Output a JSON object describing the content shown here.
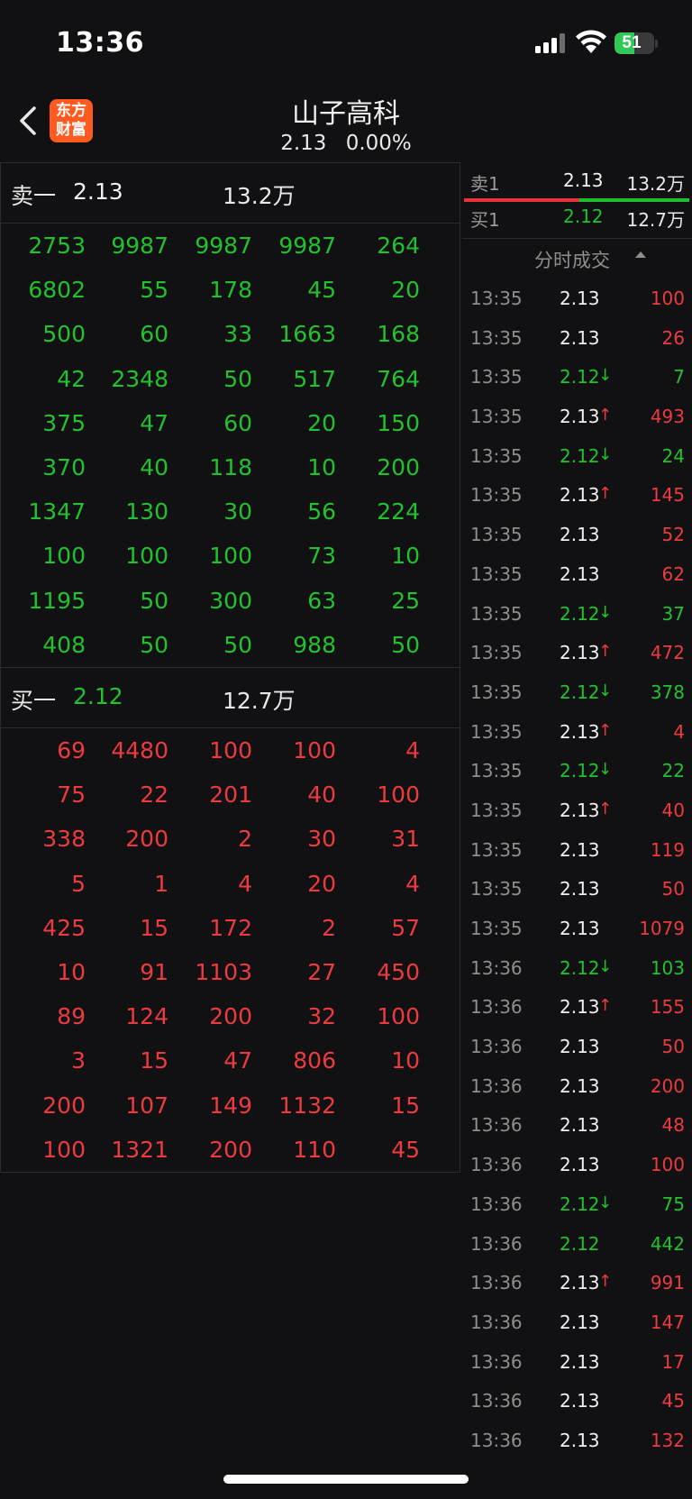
{
  "status_bar": {
    "time": "13:36",
    "battery": "51",
    "battery_level": 0.51
  },
  "header": {
    "title": "山子高科",
    "price": "2.13",
    "change_pct": "0.00%",
    "logo_line1": "东方",
    "logo_line2": "财富"
  },
  "sell_level": {
    "label": "卖一",
    "price": "2.13",
    "volume": "13.2万",
    "queue": [
      [
        "2753",
        "9987",
        "9987",
        "9987",
        "264"
      ],
      [
        "6802",
        "55",
        "178",
        "45",
        "20"
      ],
      [
        "500",
        "60",
        "33",
        "1663",
        "168"
      ],
      [
        "42",
        "2348",
        "50",
        "517",
        "764"
      ],
      [
        "375",
        "47",
        "60",
        "20",
        "150"
      ],
      [
        "370",
        "40",
        "118",
        "10",
        "200"
      ],
      [
        "1347",
        "130",
        "30",
        "56",
        "224"
      ],
      [
        "100",
        "100",
        "100",
        "73",
        "10"
      ],
      [
        "1195",
        "50",
        "300",
        "63",
        "25"
      ],
      [
        "408",
        "50",
        "50",
        "988",
        "50"
      ]
    ]
  },
  "buy_level": {
    "label": "买一",
    "price": "2.12",
    "volume": "12.7万",
    "queue": [
      [
        "69",
        "4480",
        "100",
        "100",
        "4"
      ],
      [
        "75",
        "22",
        "201",
        "40",
        "100"
      ],
      [
        "338",
        "200",
        "2",
        "30",
        "31"
      ],
      [
        "5",
        "1",
        "4",
        "20",
        "4"
      ],
      [
        "425",
        "15",
        "172",
        "2",
        "57"
      ],
      [
        "10",
        "91",
        "1103",
        "27",
        "450"
      ],
      [
        "89",
        "124",
        "200",
        "32",
        "100"
      ],
      [
        "3",
        "15",
        "47",
        "806",
        "10"
      ],
      [
        "200",
        "107",
        "149",
        "1132",
        "15"
      ],
      [
        "100",
        "1321",
        "200",
        "110",
        "45"
      ]
    ]
  },
  "quote": {
    "sell1": {
      "label": "卖1",
      "price": "2.13",
      "volume": "13.2万"
    },
    "buy1": {
      "label": "买1",
      "price": "2.12",
      "volume": "12.7万"
    },
    "sell_ratio": 0.51
  },
  "ticks_header": "分时成交",
  "ticks": [
    {
      "time": "13:35",
      "price": "2.13",
      "dir": "",
      "vol": "100",
      "pc": "white",
      "vc": "red"
    },
    {
      "time": "13:35",
      "price": "2.13",
      "dir": "",
      "vol": "26",
      "pc": "white",
      "vc": "red"
    },
    {
      "time": "13:35",
      "price": "2.12",
      "dir": "↓",
      "vol": "7",
      "pc": "green",
      "vc": "green"
    },
    {
      "time": "13:35",
      "price": "2.13",
      "dir": "↑",
      "vol": "493",
      "pc": "white",
      "vc": "red"
    },
    {
      "time": "13:35",
      "price": "2.12",
      "dir": "↓",
      "vol": "24",
      "pc": "green",
      "vc": "green"
    },
    {
      "time": "13:35",
      "price": "2.13",
      "dir": "↑",
      "vol": "145",
      "pc": "white",
      "vc": "red"
    },
    {
      "time": "13:35",
      "price": "2.13",
      "dir": "",
      "vol": "52",
      "pc": "white",
      "vc": "red"
    },
    {
      "time": "13:35",
      "price": "2.13",
      "dir": "",
      "vol": "62",
      "pc": "white",
      "vc": "red"
    },
    {
      "time": "13:35",
      "price": "2.12",
      "dir": "↓",
      "vol": "37",
      "pc": "green",
      "vc": "green"
    },
    {
      "time": "13:35",
      "price": "2.13",
      "dir": "↑",
      "vol": "472",
      "pc": "white",
      "vc": "red"
    },
    {
      "time": "13:35",
      "price": "2.12",
      "dir": "↓",
      "vol": "378",
      "pc": "green",
      "vc": "green"
    },
    {
      "time": "13:35",
      "price": "2.13",
      "dir": "↑",
      "vol": "4",
      "pc": "white",
      "vc": "red"
    },
    {
      "time": "13:35",
      "price": "2.12",
      "dir": "↓",
      "vol": "22",
      "pc": "green",
      "vc": "green"
    },
    {
      "time": "13:35",
      "price": "2.13",
      "dir": "↑",
      "vol": "40",
      "pc": "white",
      "vc": "red"
    },
    {
      "time": "13:35",
      "price": "2.13",
      "dir": "",
      "vol": "119",
      "pc": "white",
      "vc": "red"
    },
    {
      "time": "13:35",
      "price": "2.13",
      "dir": "",
      "vol": "50",
      "pc": "white",
      "vc": "red"
    },
    {
      "time": "13:35",
      "price": "2.13",
      "dir": "",
      "vol": "1079",
      "pc": "white",
      "vc": "red"
    },
    {
      "time": "13:36",
      "price": "2.12",
      "dir": "↓",
      "vol": "103",
      "pc": "green",
      "vc": "green"
    },
    {
      "time": "13:36",
      "price": "2.13",
      "dir": "↑",
      "vol": "155",
      "pc": "white",
      "vc": "red"
    },
    {
      "time": "13:36",
      "price": "2.13",
      "dir": "",
      "vol": "50",
      "pc": "white",
      "vc": "red"
    },
    {
      "time": "13:36",
      "price": "2.13",
      "dir": "",
      "vol": "200",
      "pc": "white",
      "vc": "red"
    },
    {
      "time": "13:36",
      "price": "2.13",
      "dir": "",
      "vol": "48",
      "pc": "white",
      "vc": "red"
    },
    {
      "time": "13:36",
      "price": "2.13",
      "dir": "",
      "vol": "100",
      "pc": "white",
      "vc": "red"
    },
    {
      "time": "13:36",
      "price": "2.12",
      "dir": "↓",
      "vol": "75",
      "pc": "green",
      "vc": "green"
    },
    {
      "time": "13:36",
      "price": "2.12",
      "dir": "",
      "vol": "442",
      "pc": "green",
      "vc": "green"
    },
    {
      "time": "13:36",
      "price": "2.13",
      "dir": "↑",
      "vol": "991",
      "pc": "white",
      "vc": "red"
    },
    {
      "time": "13:36",
      "price": "2.13",
      "dir": "",
      "vol": "147",
      "pc": "white",
      "vc": "red"
    },
    {
      "time": "13:36",
      "price": "2.13",
      "dir": "",
      "vol": "17",
      "pc": "white",
      "vc": "red"
    },
    {
      "time": "13:36",
      "price": "2.13",
      "dir": "",
      "vol": "45",
      "pc": "white",
      "vc": "red"
    },
    {
      "time": "13:36",
      "price": "2.13",
      "dir": "",
      "vol": "132",
      "pc": "white",
      "vc": "red"
    }
  ],
  "colors": {
    "up": "#ec3b3f",
    "down": "#22c12e",
    "neutral": "#f0f0f0",
    "logo": "#ff5a1f"
  },
  "icons": [
    "back-chevron-icon",
    "cellular-signal-icon",
    "wifi-icon",
    "battery-icon",
    "sort-ascending-icon"
  ]
}
